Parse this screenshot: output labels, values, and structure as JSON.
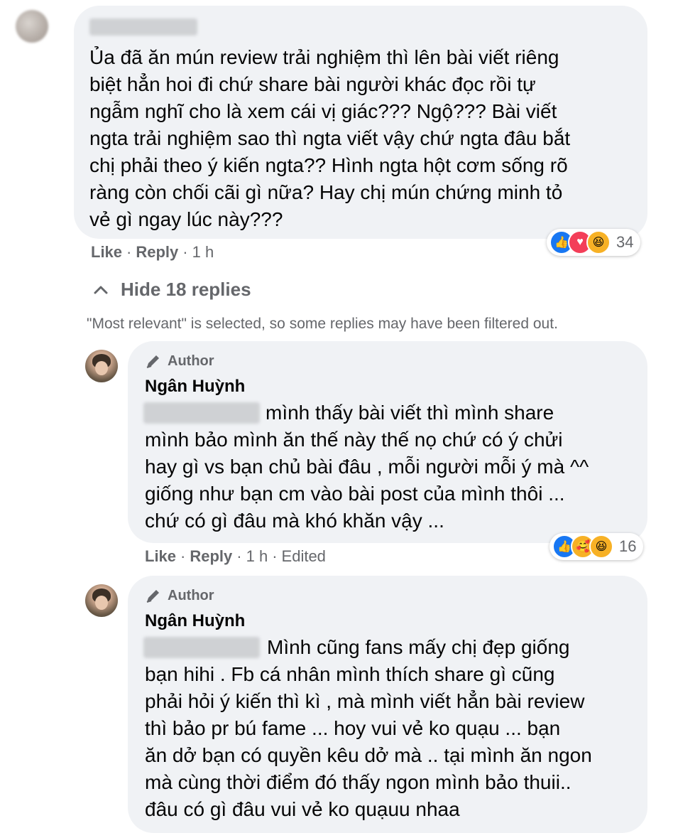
{
  "comment": {
    "text": "Ủa đã ăn mún review trải nghiệm thì lên bài viết riêng\nbiệt hẳn hoi đi chứ share bài người khác đọc rồi tự\nngẫm nghĩ cho là xem cái vị giác??? Ngộ??? Bài viết\nngta trải nghiệm sao thì ngta viết vậy chứ ngta đâu bắt\nchị phải theo ý kiến ngta?? Hình ngta hột cơm sống rõ\nràng còn chối cãi gì nữa? Hay chị mún chứng minh tỏ\nvẻ gì ngay lúc này???",
    "like": "Like",
    "reply": "Reply",
    "sep": "·",
    "time": "1 h",
    "reaction_count": "34",
    "reactions": [
      "like-icon",
      "love-icon",
      "haha-icon"
    ]
  },
  "replies_toggle": {
    "label": "Hide 18 replies",
    "note": "\"Most relevant\" is selected, so some replies may have been filtered out."
  },
  "replies": [
    {
      "badge": "Author",
      "name": "Ngân Huỳnh",
      "first_line": "mình thấy bài viết thì mình share",
      "text": "mình bảo mình ăn thế này thế nọ chứ có ý chửi\nhay gì vs bạn chủ bài đâu , mỗi người mỗi ý mà ^^\ngiống như bạn cm vào bài post của mình thôi ...\nchứ có gì đâu mà khó khăn vậy ...",
      "like": "Like",
      "reply": "Reply",
      "sep": "·",
      "time": "1 h",
      "edited": "Edited",
      "reaction_count": "16",
      "reactions": [
        "like-icon",
        "care-icon",
        "haha-icon"
      ]
    },
    {
      "badge": "Author",
      "name": "Ngân Huỳnh",
      "first_line": "Mình cũng fans mấy chị đẹp giống",
      "text": "bạn hihi . Fb cá nhân mình thích share gì cũng\nphải hỏi ý kiến thì kì , mà mình viết hẳn bài review\nthì bảo pr bú fame ... hoy vui vẻ ko quạu ... bạn\năn dở bạn có quyền kêu dở mà .. tại mình ăn ngon\nmà cùng thời điểm đó thấy ngon mình bảo thuii..\nđâu có gì đâu vui vẻ ko quạuu nhaa"
    }
  ]
}
